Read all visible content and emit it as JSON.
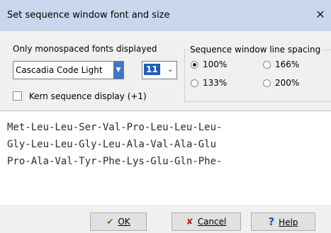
{
  "window": {
    "title": "Set sequence window font and size",
    "close_glyph": "✕"
  },
  "font": {
    "label": "Only monospaced fonts displayed",
    "selected": "Cascadia Code Light",
    "size": "11"
  },
  "kern": {
    "label": "Kern sequence display (+1)",
    "checked": false
  },
  "spacing": {
    "legend": "Sequence window line spacing",
    "options": [
      {
        "label": "100%",
        "checked": true
      },
      {
        "label": "166%",
        "checked": false
      },
      {
        "label": "133%",
        "checked": false
      },
      {
        "label": "200%",
        "checked": false
      }
    ]
  },
  "sequence": {
    "lines": [
      "Met-Leu-Leu-Ser-Val-Pro-Leu-Leu-Leu-",
      "Gly-Leu-Leu-Gly-Leu-Ala-Val-Ala-Glu",
      "Pro-Ala-Val-Tyr-Phe-Lys-Glu-Gln-Phe-"
    ]
  },
  "buttons": {
    "ok": {
      "label": "OK",
      "icon": "checkmark-icon"
    },
    "cancel": {
      "label": "Cancel",
      "icon": "x-icon"
    },
    "help": {
      "label": "Help",
      "icon": "question-icon"
    }
  },
  "colors": {
    "titlebar": "#c8d7eb",
    "selection": "#1e5fb4",
    "ok_icon": "#2e8b1d",
    "cancel_icon": "#c8161d",
    "help_icon": "#1b55b8"
  }
}
